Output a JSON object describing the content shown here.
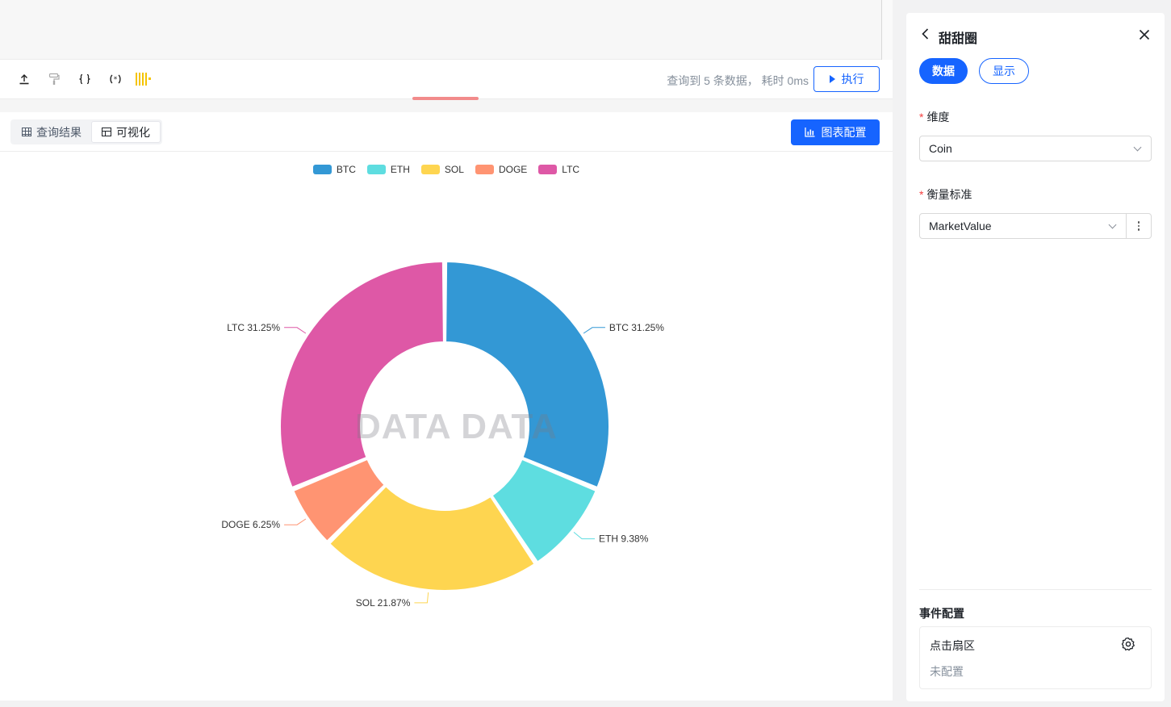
{
  "toolbar": {
    "icons": [
      "upload-icon",
      "format-brush-icon",
      "braces-icon",
      "parameter-icon",
      "barcode-icon"
    ],
    "query_info": "查询到 5 条数据，  耗时 0ms",
    "run_label": "执行"
  },
  "result_tabs": [
    {
      "label": "查询结果",
      "active": false
    },
    {
      "label": "可视化",
      "active": true
    }
  ],
  "chart_config_label": "图表配置",
  "watermark": "DATA DATA",
  "chart_data": {
    "type": "pie",
    "variant": "donut",
    "categories": [
      "BTC",
      "ETH",
      "SOL",
      "DOGE",
      "LTC"
    ],
    "values": [
      31.25,
      9.38,
      21.87,
      6.25,
      31.25
    ],
    "value_format": "percent",
    "labels": [
      "BTC 31.25%",
      "ETH 9.38%",
      "SOL 21.87%",
      "DOGE 6.25%",
      "LTC 31.25%"
    ],
    "colors": [
      "#3398d5",
      "#5edde0",
      "#fed550",
      "#ff9472",
      "#de58a6"
    ],
    "legend_position": "top-center"
  },
  "panel": {
    "title": "甜甜圈",
    "tabs": [
      {
        "label": "数据",
        "active": true
      },
      {
        "label": "显示",
        "active": false
      }
    ],
    "dimension_label": "维度",
    "dimension_value": "Coin",
    "measure_label": "衡量标准",
    "measure_value": "MarketValue",
    "event_title": "事件配置",
    "event_name": "点击扇区",
    "event_status": "未配置"
  },
  "colors": {
    "primary": "#1664ff",
    "required": "#f53f3f",
    "splitter_handle": "#f28b8b"
  }
}
